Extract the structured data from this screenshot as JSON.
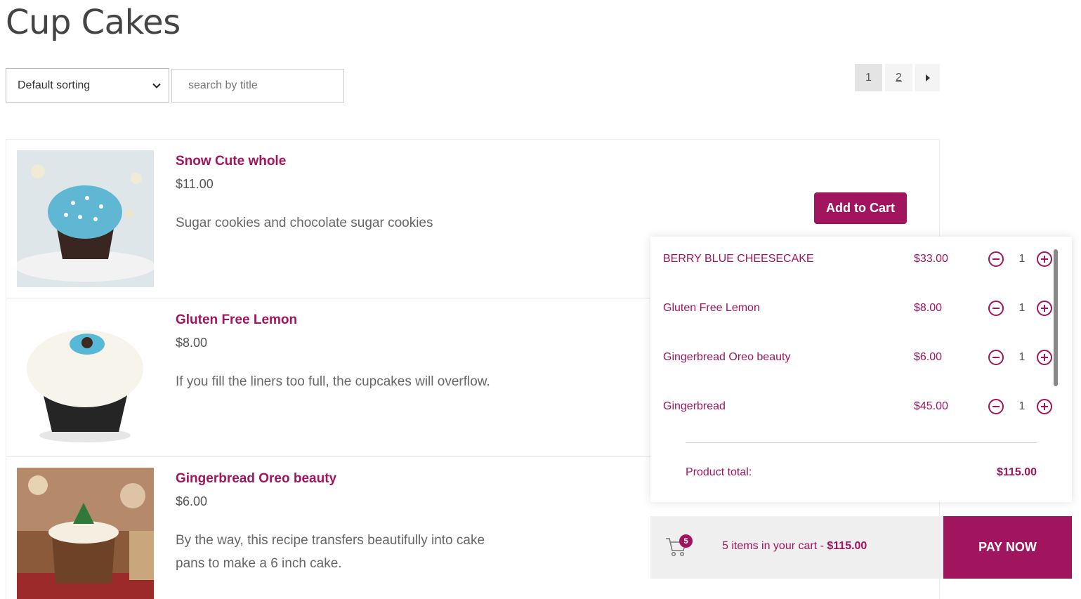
{
  "page": {
    "title": "Cup Cakes"
  },
  "controls": {
    "sort_selected": "Default sorting",
    "search_placeholder": "search by title"
  },
  "pagination": {
    "pages": [
      "1",
      "2"
    ],
    "current": "1"
  },
  "products": [
    {
      "name": "Snow Cute whole",
      "price": "$11.00",
      "description": "Sugar cookies and chocolate sugar cookies"
    },
    {
      "name": "Gluten Free Lemon",
      "price": "$8.00",
      "description": "If you fill the liners too full, the cupcakes will overflow."
    },
    {
      "name": "Gingerbread Oreo beauty",
      "price": "$6.00",
      "description": "By the way, this recipe transfers beautifully into cake pans to make a 6 inch cake."
    }
  ],
  "add_to_cart_label": "Add to Cart",
  "cart": {
    "items": [
      {
        "name": "BERRY BLUE CHEESECAKE",
        "price": "$33.00",
        "qty": "1"
      },
      {
        "name": "Gluten Free Lemon",
        "price": "$8.00",
        "qty": "1"
      },
      {
        "name": "Gingerbread Oreo beauty",
        "price": "$6.00",
        "qty": "1"
      },
      {
        "name": "Gingerbread",
        "price": "$45.00",
        "qty": "1"
      }
    ],
    "total_label": "Product total:",
    "total_value": "$115.00",
    "badge_count": "5",
    "summary_text": "5 items in your cart - ",
    "summary_total": "$115.00",
    "pay_label": "PAY NOW"
  },
  "colors": {
    "accent": "#a0155d"
  },
  "icons": {
    "sort": "chevron-down-icon",
    "next": "caret-right-icon",
    "minus": "minus-circle-icon",
    "plus": "plus-circle-icon",
    "cart": "cart-icon"
  }
}
